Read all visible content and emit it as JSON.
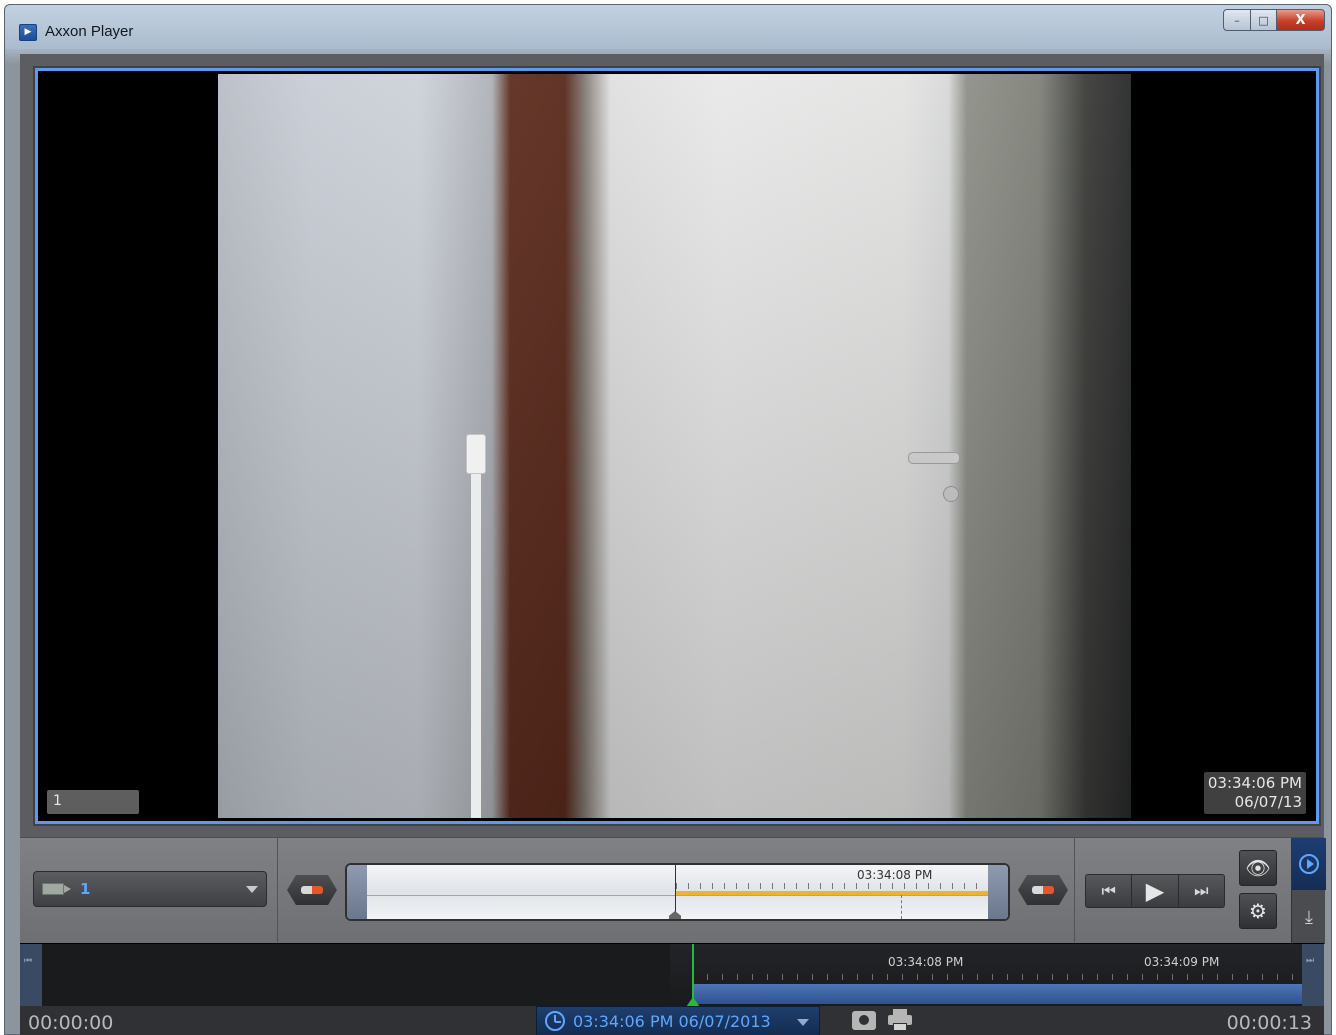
{
  "window": {
    "title": "Axxon Player",
    "icon": "app-icon",
    "buttons": {
      "minimize": "–",
      "maximize": "□",
      "close": "X"
    }
  },
  "video": {
    "camera_label": "1",
    "timestamp_time": "03:34:06 PM",
    "timestamp_date": "06/07/13"
  },
  "controls": {
    "camera_select": {
      "value": "1",
      "icon": "camera-icon"
    },
    "mini_timeline": {
      "time_label": "03:34:08 PM"
    },
    "transport": {
      "prev": "⏮",
      "play": "▶",
      "next": "⏭"
    },
    "eye_icon": "eye-icon",
    "gear_icon": "gear-icon"
  },
  "timeline": {
    "labels": [
      "03:34:08 PM",
      "03:34:09 PM"
    ]
  },
  "status": {
    "start_time": "00:00:00",
    "current_datetime": "03:34:06 PM 06/07/2013",
    "end_time": "00:00:13"
  },
  "colors": {
    "accent": "#5fa6ff",
    "selection_border": "#5b9bef",
    "cursor_green": "#27b83c",
    "archive_bar": "#f0b12b"
  }
}
